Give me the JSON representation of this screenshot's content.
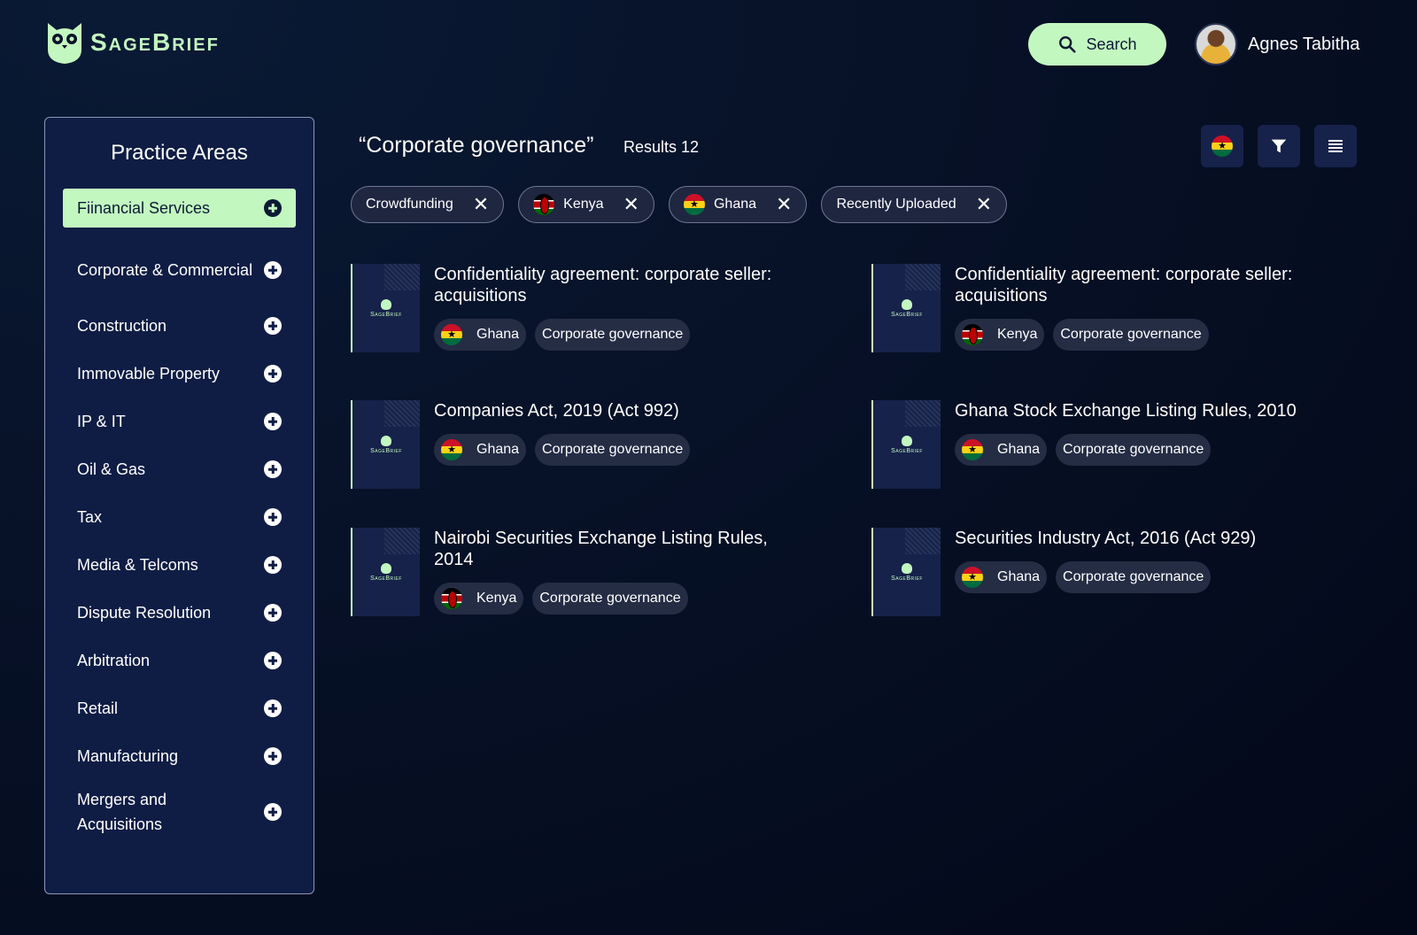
{
  "brand": {
    "name": "SageBrief",
    "accent": "#c3f7c0"
  },
  "header": {
    "search_label": "Search",
    "user_name": "Agnes Tabitha"
  },
  "sidebar": {
    "title": "Practice Areas",
    "items": [
      {
        "label": "Fiinancial Services",
        "active": true
      },
      {
        "label": "Corporate & Commercial"
      },
      {
        "label": "Construction"
      },
      {
        "label": "Immovable Property"
      },
      {
        "label": "IP & IT"
      },
      {
        "label": "Oil & Gas"
      },
      {
        "label": "Tax"
      },
      {
        "label": "Media & Telcoms"
      },
      {
        "label": "Dispute Resolution"
      },
      {
        "label": "Arbitration"
      },
      {
        "label": "Retail"
      },
      {
        "label": "Manufacturing"
      },
      {
        "label": "Mergers and Acquisitions"
      }
    ]
  },
  "main": {
    "query": "“Corporate governance”",
    "results_label": "Results 12",
    "filters": [
      {
        "label": "Crowdfunding",
        "flag": ""
      },
      {
        "label": "Kenya",
        "flag": "kenya"
      },
      {
        "label": "Ghana",
        "flag": "ghana"
      },
      {
        "label": "Recently Uploaded",
        "flag": ""
      }
    ],
    "cards": [
      {
        "title": "Confidentiality agreement: corporate seller: acquisitions",
        "country": "Ghana",
        "flag": "ghana",
        "tag": "Corporate governance"
      },
      {
        "title": "Confidentiality agreement: corporate seller: acquisitions",
        "country": "Kenya",
        "flag": "kenya",
        "tag": "Corporate governance"
      },
      {
        "title": "Companies Act, 2019 (Act 992)",
        "country": "Ghana",
        "flag": "ghana",
        "tag": "Corporate governance"
      },
      {
        "title": "Ghana Stock Exchange Listing Rules, 2010",
        "country": "Ghana",
        "flag": "ghana",
        "tag": "Corporate governance"
      },
      {
        "title": "Nairobi Securities Exchange Listing Rules, 2014",
        "country": "Kenya",
        "flag": "kenya",
        "tag": "Corporate governance"
      },
      {
        "title": "Securities Industry Act, 2016 (Act 929)",
        "country": "Ghana",
        "flag": "ghana",
        "tag": "Corporate governance"
      }
    ],
    "thumb_brand": "SageBrief"
  }
}
